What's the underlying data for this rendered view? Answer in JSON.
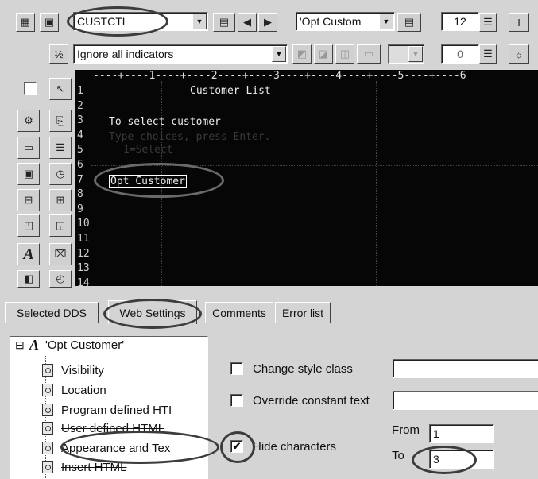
{
  "toolbar": {
    "record_name": "CUSTCTL",
    "field_combo": "'Opt Custom",
    "font_size": "12",
    "indicator_label": "Ignore all indicators",
    "spin_value": "0"
  },
  "terminal": {
    "ruler": "----+----1----+----2----+----3----+----4----+----5----+----6",
    "line_numbers": [
      "1",
      "2",
      "3",
      "4",
      "5",
      "6",
      "7",
      "8",
      "9",
      "10",
      "11",
      "12",
      "13",
      "14"
    ],
    "rows": {
      "title": "Customer List",
      "select_prompt": "To select customer",
      "type_choices": "Type choices, press Enter.",
      "select_option": "1=Select",
      "opt_customer": "Opt Customer"
    }
  },
  "tabs": [
    "Selected DDS",
    "Web Settings",
    "Comments",
    "Error list"
  ],
  "tree": {
    "root": "'Opt Customer'",
    "expander": "⊟",
    "root_glyph": "A",
    "items": [
      "Visibility",
      "Location",
      "Program defined HTI",
      "User defined HTML",
      "Appearance and Tex",
      "Insert HTML"
    ]
  },
  "settings": {
    "change_style_label": "Change style class",
    "change_style_checked": false,
    "override_label": "Override constant text",
    "override_checked": false,
    "hide_label": "Hide characters",
    "hide_checked": true,
    "from_label": "From",
    "from_value": "1",
    "to_label": "To",
    "to_value": "3"
  },
  "icons": {
    "check_mark": "✔",
    "fraction": "½",
    "font_glyph": "A",
    "arrow_down": "▼",
    "arrow_left": "◀",
    "arrow_right": "▶"
  }
}
